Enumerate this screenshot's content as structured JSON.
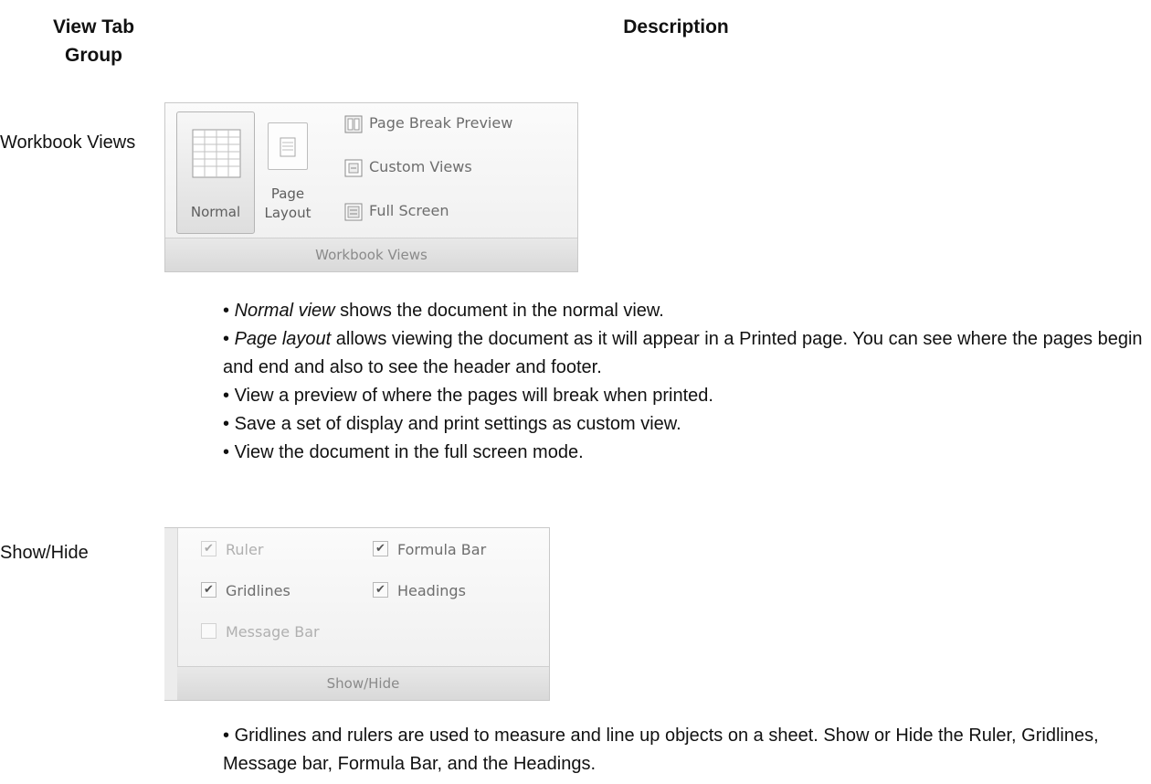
{
  "table": {
    "header_col1": "View Tab Group",
    "header_col2": "Description"
  },
  "rows": [
    {
      "group": "Workbook Views",
      "ribbon": {
        "caption": "Workbook Views",
        "big_buttons": [
          {
            "label": "Normal",
            "icon": "grid-icon",
            "selected": true
          },
          {
            "label": "Page Layout",
            "icon": "page-icon",
            "selected": false
          }
        ],
        "small_buttons": [
          {
            "label": "Page Break Preview",
            "icon": "page-break-icon"
          },
          {
            "label": "Custom Views",
            "icon": "custom-views-icon"
          },
          {
            "label": "Full Screen",
            "icon": "full-screen-icon"
          }
        ]
      },
      "bullets": [
        {
          "italic": "Normal view",
          "text": " shows the document in the normal view."
        },
        {
          "italic": "Page layout",
          "text": " allows viewing the document as it will appear in a Printed page. You can see where the pages begin and end and also to see the header and footer."
        },
        {
          "italic": "",
          "text": "View a preview of where the pages will break when printed."
        },
        {
          "italic": "",
          "text": "Save a set of display and print settings as custom view."
        },
        {
          "italic": "",
          "text": "View the document in the full screen mode."
        }
      ]
    },
    {
      "group": "Show/Hide",
      "ribbon": {
        "caption": "Show/Hide",
        "checkboxes": [
          {
            "label": "Ruler",
            "checked": true,
            "enabled": false
          },
          {
            "label": "Formula Bar",
            "checked": true,
            "enabled": true
          },
          {
            "label": "Gridlines",
            "checked": true,
            "enabled": true
          },
          {
            "label": "Headings",
            "checked": true,
            "enabled": true
          },
          {
            "label": "Message Bar",
            "checked": false,
            "enabled": false
          }
        ]
      },
      "bullets": [
        {
          "italic": "",
          "text": "Gridlines and rulers are used to measure and line up objects on a sheet. Show or Hide the Ruler, Gridlines, Message bar, Formula Bar, and the Headings."
        }
      ]
    }
  ]
}
